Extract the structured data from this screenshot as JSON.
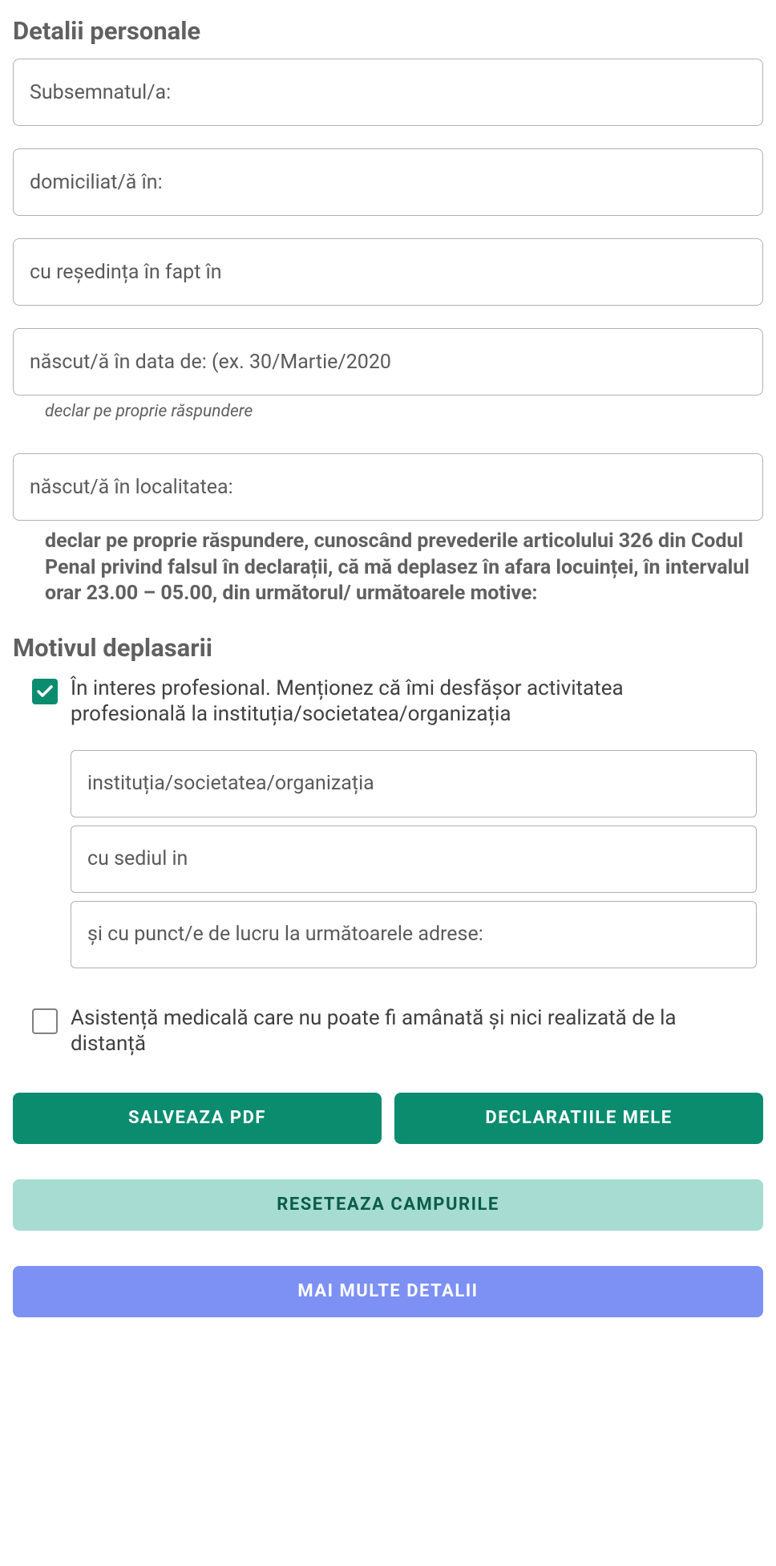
{
  "personal": {
    "title": "Detalii personale",
    "fields": {
      "name_placeholder": "Subsemnatul/a:",
      "address_placeholder": "domiciliat/ă în:",
      "residence_placeholder": "cu reședința în fapt în",
      "birthdate_placeholder": "născut/ă în data de: (ex. 30/Martie/2020",
      "birthdate_helper": "declar pe proprie răspundere",
      "birthplace_placeholder": "născut/ă în localitatea:"
    },
    "legal_text": "declar pe proprie răspundere, cunoscând prevederile articolului 326 din Codul Penal privind falsul în declarații, că mă deplasez în afara locuinței, în intervalul orar 23.00 – 05.00, din următorul/ următoarele motive:"
  },
  "reason": {
    "title": "Motivul deplasarii",
    "professional": {
      "label": "În interes profesional. Menționez că îmi desfășor activitatea profesională la instituția/societatea/organizația",
      "org_placeholder": "instituția/societatea/organizația",
      "hq_placeholder": "cu sediul in",
      "workpoints_placeholder": "și cu punct/e de lucru la următoarele adrese:"
    },
    "medical": {
      "label": "Asistență medicală care nu poate fi amânată și nici realizată de la distanță"
    }
  },
  "buttons": {
    "save_pdf": "SALVEAZA PDF",
    "my_declarations": "DECLARATIILE MELE",
    "reset_fields": "RESETEAZA CAMPURILE",
    "more_details": "MAI MULTE DETALII"
  }
}
